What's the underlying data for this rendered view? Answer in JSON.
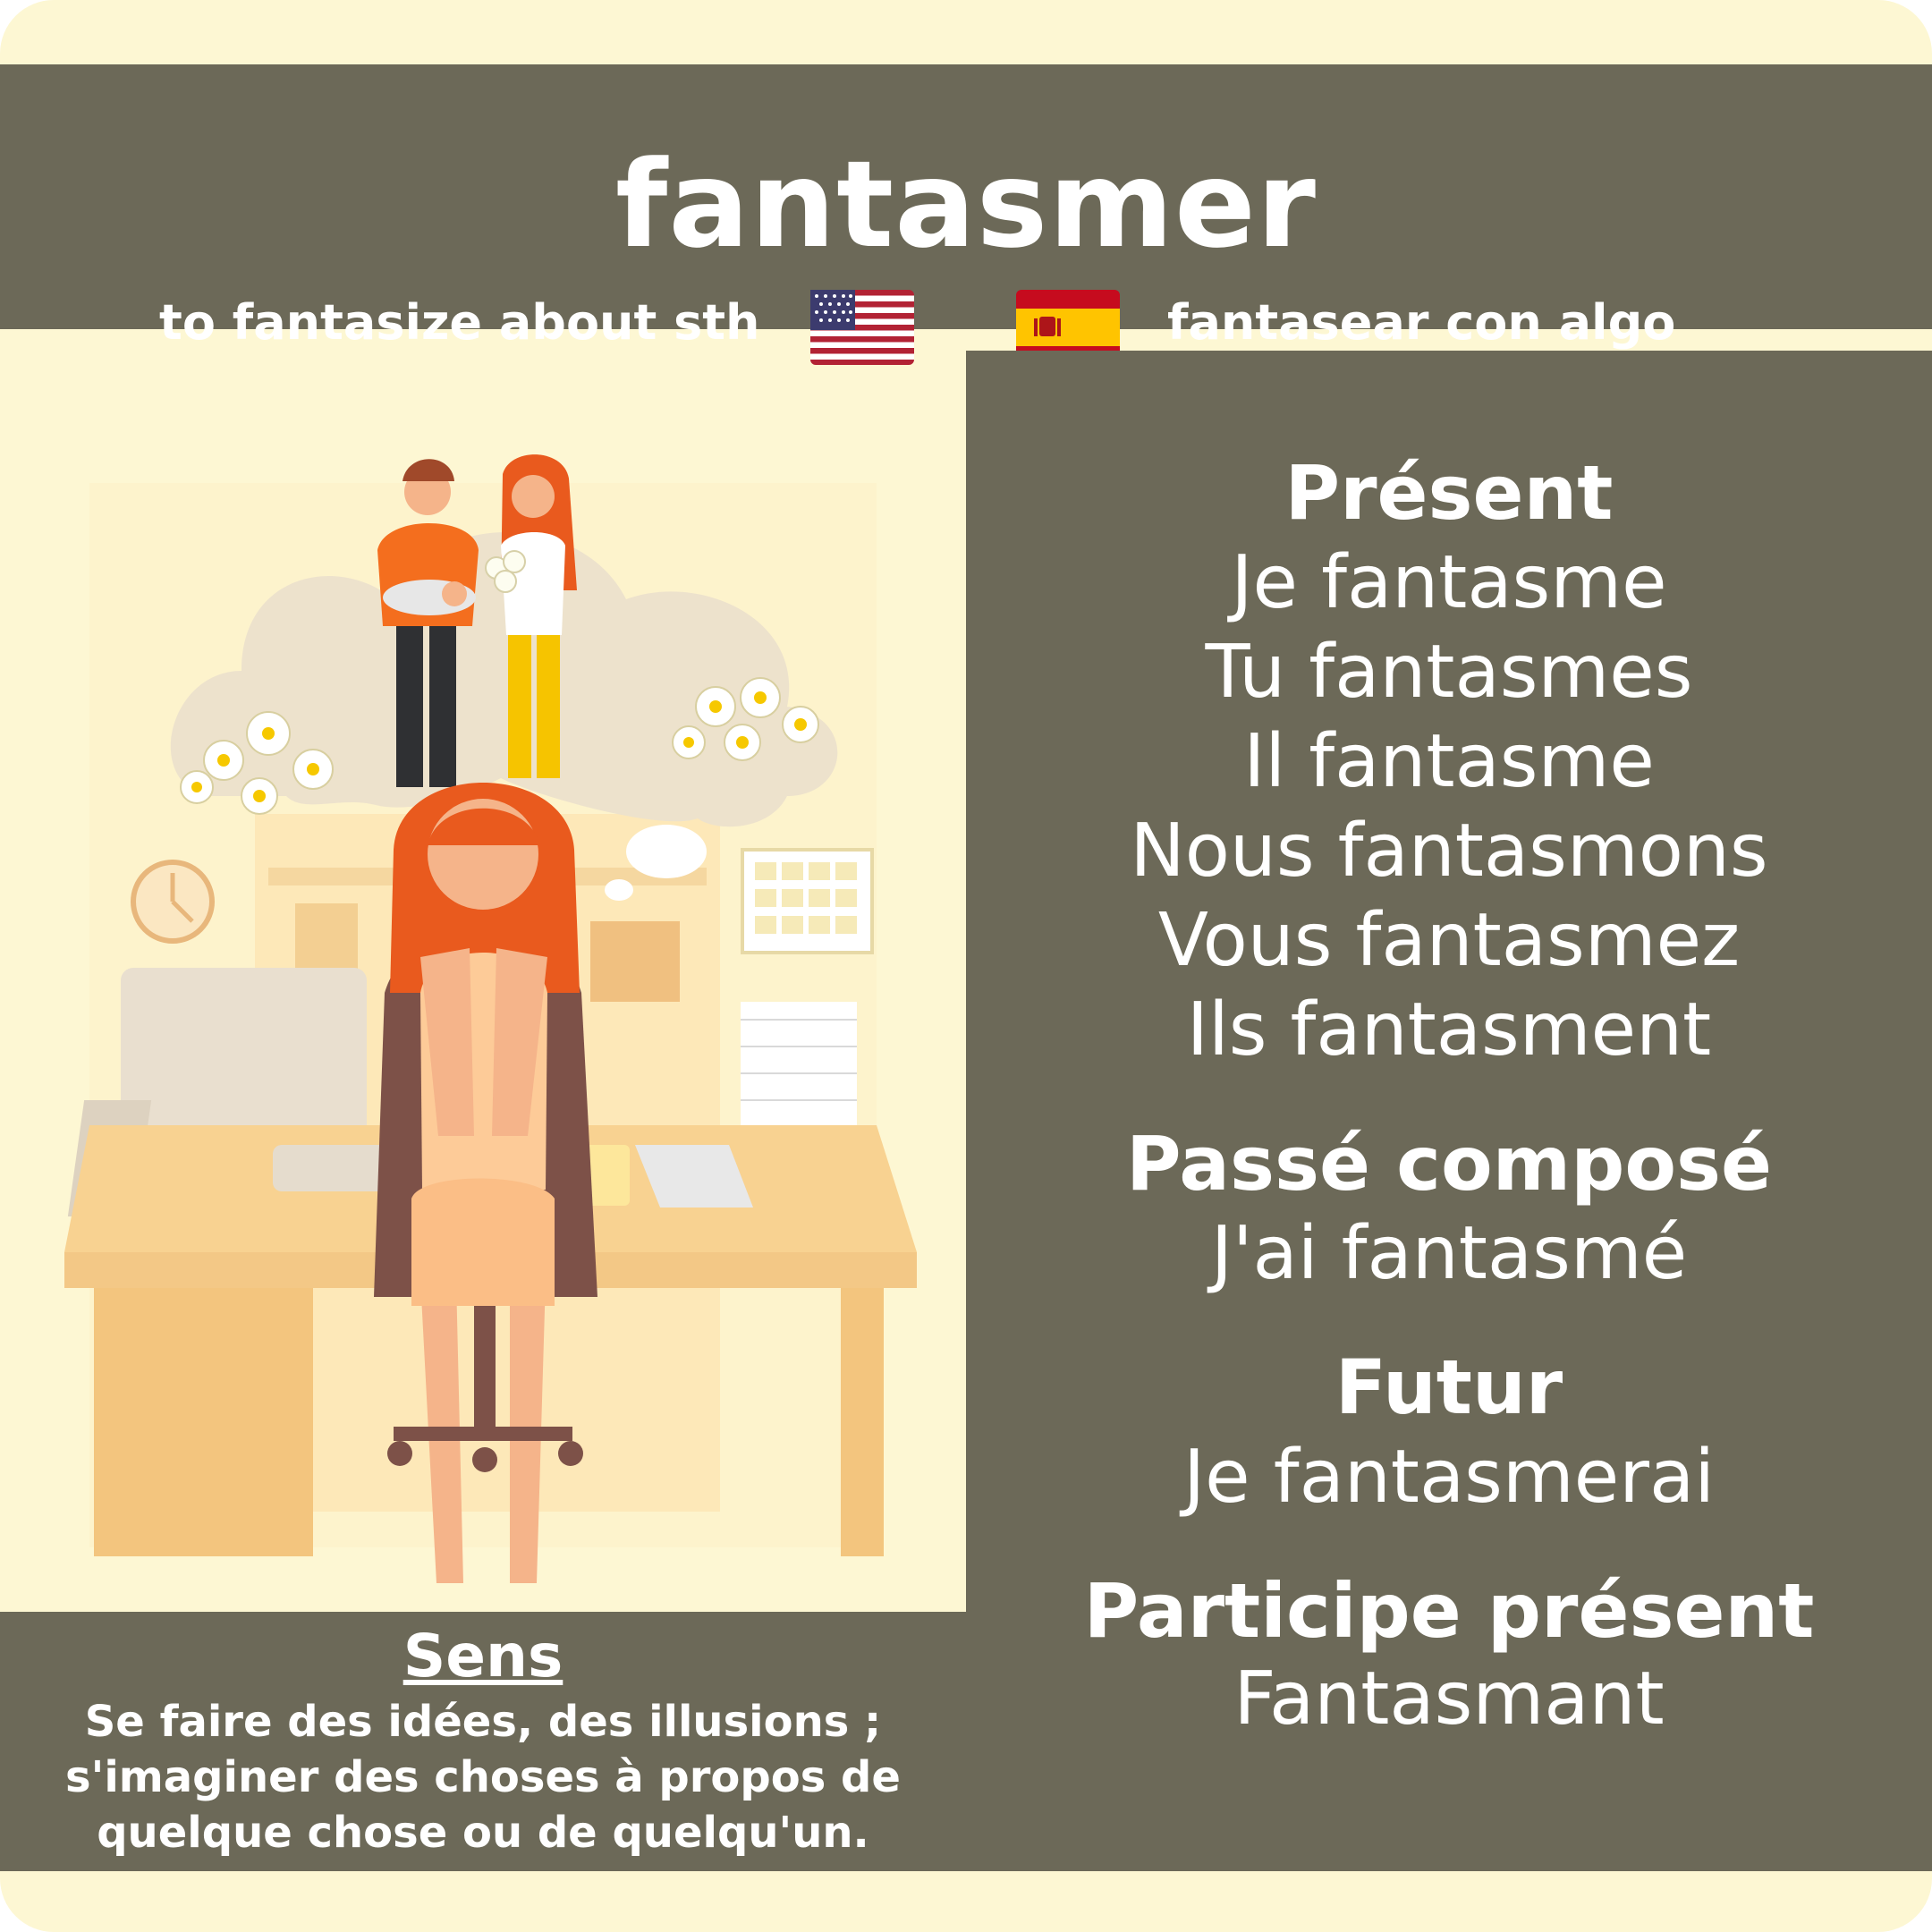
{
  "verb": "fantasmer",
  "translations": {
    "english": "to fantasize about sth",
    "spanish": "fantasear con algo"
  },
  "flags": [
    "us-flag-icon",
    "spain-flag-icon"
  ],
  "conjugation": {
    "present": {
      "title": "Présent",
      "forms": [
        "Je fantasme",
        "Tu fantasmes",
        "Il fantasme",
        "Nous fantasmons",
        "Vous fantasmez",
        "Ils fantasment"
      ]
    },
    "passe_compose": {
      "title": "Passé composé",
      "form": "J'ai fantasmé"
    },
    "futur": {
      "title": "Futur",
      "form": "Je fantasmerai"
    },
    "participe_present": {
      "title": "Participe présent",
      "form": "Fantasmant"
    }
  },
  "sens": {
    "title": "Sens",
    "text": "Se faire des idées, des illusions ; s'imaginer des choses à propos de quelque chose ou de quelqu'un."
  },
  "colors": {
    "background": "#fdf7d3",
    "panel": "#6c6958",
    "text": "#ffffff"
  }
}
